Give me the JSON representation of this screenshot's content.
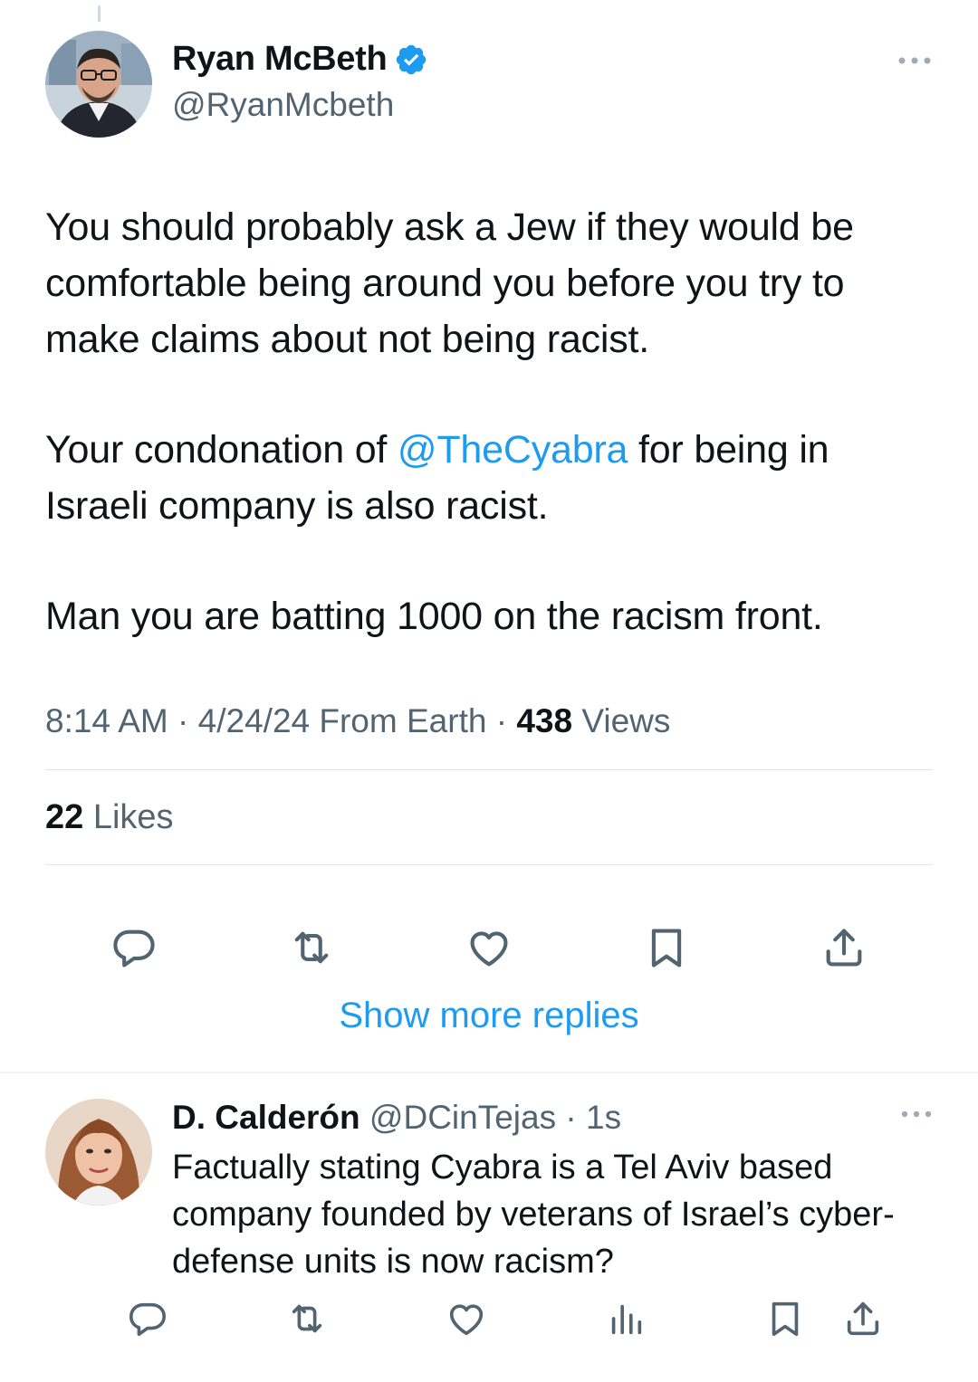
{
  "main_tweet": {
    "author_name": "Ryan McBeth",
    "author_handle": "@RyanMcbeth",
    "paragraph1": "You should probably ask a Jew if they would be comfortable being around you before you try to make claims about not being racist.",
    "paragraph2_pre": "Your condonation of ",
    "paragraph2_mention": "@TheCyabra",
    "paragraph2_post": " for being in Israeli company is also racist.",
    "paragraph3": "Man you are batting 1000 on the racism front.",
    "time": "8:14 AM",
    "sep1": " · ",
    "date": "4/24/24",
    "location": " From Earth",
    "sep2": " · ",
    "views_count": "438",
    "views_label": " Views",
    "likes_count": "22",
    "likes_label": " Likes",
    "more_icon": "more-horizontal-icon",
    "actions": [
      "reply-icon",
      "retweet-icon",
      "like-icon",
      "bookmark-icon",
      "share-icon"
    ]
  },
  "show_more_replies": "Show more replies",
  "reply": {
    "author_name": "D. Calderón",
    "author_handle": "@DCinTejas",
    "sep": " · ",
    "time_ago": "1s",
    "text": "Factually stating Cyabra is a Tel Aviv based company founded by veterans of Israel’s cyber-defense units is now racism?",
    "actions": [
      "reply-icon",
      "retweet-icon",
      "like-icon",
      "views-icon",
      "bookmark-icon",
      "share-icon"
    ]
  },
  "colors": {
    "accent": "#1d9bf0",
    "text": "#0f1419",
    "secondary": "#536471",
    "icon": "#536471"
  }
}
